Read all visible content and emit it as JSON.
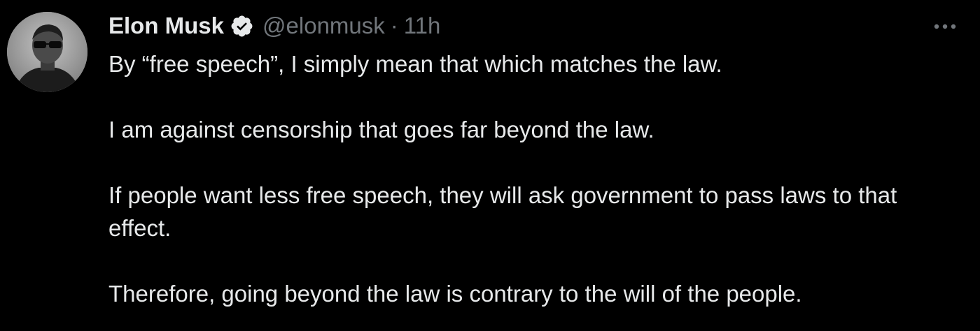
{
  "author": {
    "display_name": "Elon Musk",
    "handle": "@elonmusk",
    "separator": "·",
    "time": "11h"
  },
  "tweet": {
    "paragraphs": [
      "By “free speech”, I simply mean that which matches the law.",
      "I am against censorship that goes far beyond the law.",
      "If people want less free speech, they will ask government to pass laws to that effect.",
      "Therefore, going beyond the law is contrary to the will of the people."
    ]
  },
  "icons": {
    "verified": "verified-badge-icon",
    "more": "more-options-icon"
  },
  "colors": {
    "background": "#000000",
    "primary_text": "#e7e9ea",
    "secondary_text": "#71767b"
  }
}
